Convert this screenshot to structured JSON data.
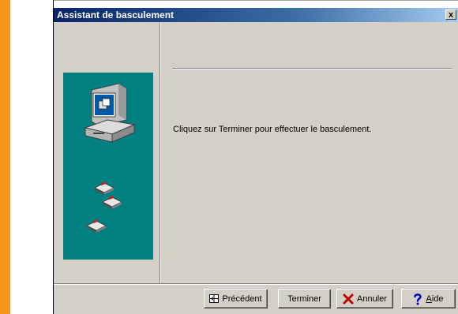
{
  "dialog": {
    "title": "Assistant de basculement",
    "close_glyph": "x",
    "message": "Cliquez sur Terminer pour effectuer le basculement.",
    "illustration": {
      "background": "#008080",
      "icons": [
        "computer-icon",
        "floppy-disk-icon",
        "floppy-disk-icon",
        "floppy-disk-icon"
      ]
    }
  },
  "buttons": {
    "previous": {
      "label": "Précédent",
      "icon": "previous-icon"
    },
    "finish": {
      "label": "Terminer"
    },
    "cancel": {
      "label": "Annuler",
      "icon": "red-x-icon"
    },
    "help": {
      "label_accel": "A",
      "label_rest": "ide",
      "icon": "question-icon"
    }
  },
  "colors": {
    "accent_bar": "#f7941d",
    "titlebar_start": "#0a246a",
    "titlebar_end": "#a6caf0",
    "dialog_face": "#d4d0c8"
  }
}
